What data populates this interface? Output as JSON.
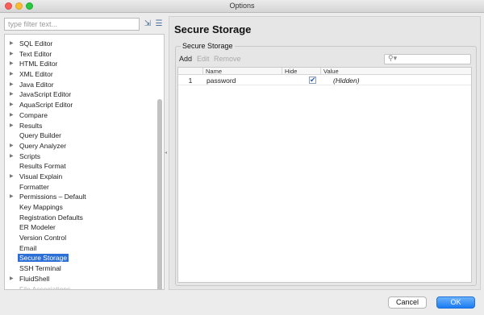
{
  "window": {
    "title": "Options"
  },
  "left": {
    "filter_placeholder": "type filter text...",
    "tree": [
      {
        "label": "SQL Editor",
        "expandable": true
      },
      {
        "label": "Text Editor",
        "expandable": true
      },
      {
        "label": "HTML Editor",
        "expandable": true
      },
      {
        "label": "XML Editor",
        "expandable": true
      },
      {
        "label": "Java Editor",
        "expandable": true
      },
      {
        "label": "JavaScript Editor",
        "expandable": true
      },
      {
        "label": "AquaScript Editor",
        "expandable": true
      },
      {
        "label": "Compare",
        "expandable": true
      },
      {
        "label": "Results",
        "expandable": true
      },
      {
        "label": "Query Builder",
        "expandable": false
      },
      {
        "label": "Query Analyzer",
        "expandable": true
      },
      {
        "label": "Scripts",
        "expandable": true
      },
      {
        "label": "Results Format",
        "expandable": false
      },
      {
        "label": "Visual Explain",
        "expandable": true
      },
      {
        "label": "Formatter",
        "expandable": false
      },
      {
        "label": "Permissions – Default",
        "expandable": true
      },
      {
        "label": "Key Mappings",
        "expandable": false
      },
      {
        "label": "Registration Defaults",
        "expandable": false
      },
      {
        "label": "ER Modeler",
        "expandable": false
      },
      {
        "label": "Version Control",
        "expandable": false
      },
      {
        "label": "Email",
        "expandable": false
      },
      {
        "label": "Secure Storage",
        "expandable": false,
        "selected": true
      },
      {
        "label": "SSH Terminal",
        "expandable": false
      },
      {
        "label": "FluidShell",
        "expandable": true
      },
      {
        "label": "File Associations",
        "expandable": false,
        "faded": true
      }
    ]
  },
  "main": {
    "title": "Secure Storage",
    "group_title": "Secure Storage",
    "actions": {
      "add": "Add",
      "edit": "Edit",
      "remove": "Remove"
    },
    "table": {
      "headers": {
        "name": "Name",
        "hide": "Hide",
        "value": "Value"
      },
      "rows": [
        {
          "num": "1",
          "name": "password",
          "hide": true,
          "value": "(Hidden)"
        }
      ]
    }
  },
  "footer": {
    "cancel": "Cancel",
    "ok": "OK"
  },
  "colors": {
    "selection": "#2c6fd6",
    "ok_button": "#1b7bf3"
  }
}
